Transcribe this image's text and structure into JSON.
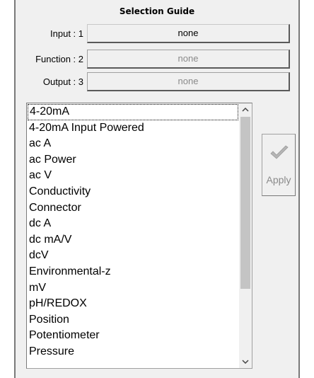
{
  "header": {
    "title": "Selection Guide"
  },
  "rows": [
    {
      "label": "Input : 1",
      "value": "none"
    },
    {
      "label": "Function : 2",
      "value": "none"
    },
    {
      "label": "Output : 3",
      "value": "none"
    }
  ],
  "list": {
    "items": [
      "4-20mA",
      "4-20mA Input Powered",
      "ac A",
      "ac Power",
      "ac V",
      "Conductivity",
      "Connector",
      "dc A",
      "dc mA/V",
      "dcV",
      "Environmental-z",
      "mV",
      "pH/REDOX",
      "Position",
      "Potentiometer",
      "Pressure"
    ]
  },
  "apply": {
    "label": "Apply",
    "icon": "checkmark-icon"
  },
  "scrollbar": {
    "up_icon": "chevron-up-icon",
    "down_icon": "chevron-down-icon"
  }
}
